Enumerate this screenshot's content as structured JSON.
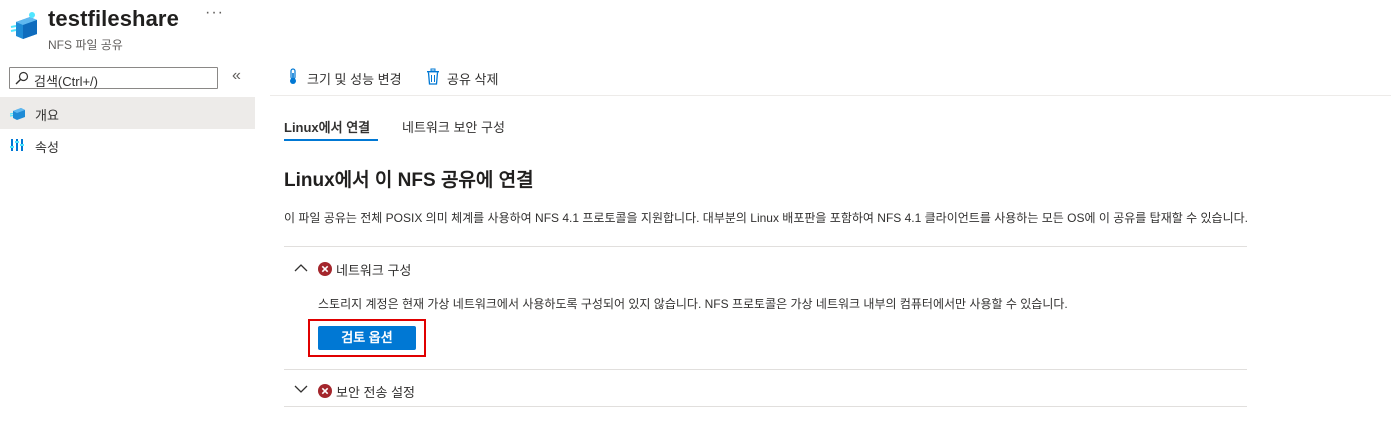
{
  "header": {
    "title": "testfileshare",
    "subtitle": "NFS 파일 공유",
    "more_label": "···",
    "icon": "file-share-icon"
  },
  "sidebar": {
    "search_placeholder": "검색(Ctrl+/)",
    "collapse_label": "«",
    "items": [
      {
        "label": "개요",
        "icon": "overview-icon",
        "selected": true
      },
      {
        "label": "속성",
        "icon": "properties-icon",
        "selected": false
      }
    ]
  },
  "toolbar": {
    "resize_label": "크기 및 성능 변경",
    "delete_label": "공유 삭제"
  },
  "tabs": [
    {
      "label": "Linux에서 연결",
      "active": true
    },
    {
      "label": "네트워크 보안 구성",
      "active": false
    }
  ],
  "content": {
    "title": "Linux에서 이 NFS 공유에 연결",
    "description": "이 파일 공유는 전체 POSIX 의미 체계를 사용하여 NFS 4.1 프로토콜을 지원합니다. 대부분의 Linux 배포판을 포함하여 NFS 4.1 클라이언트를 사용하는 모든 OS에 이 공유를 탑재할 수 있습니다.",
    "accordions": [
      {
        "title": "네트워크 구성",
        "expanded": true,
        "status": "error",
        "text": "스토리지 계정은 현재 가상 네트워크에서 사용하도록 구성되어 있지 않습니다. NFS 프로토콜은 가상 네트워크 내부의 컴퓨터에서만 사용할 수 있습니다.",
        "button_label": "검토 옵션"
      },
      {
        "title": "보안 전송 설정",
        "expanded": false,
        "status": "error"
      }
    ]
  },
  "colors": {
    "accent": "#0078d4",
    "error": "#a4262c",
    "highlight": "#e00000",
    "selected_bg": "#edebe9"
  }
}
